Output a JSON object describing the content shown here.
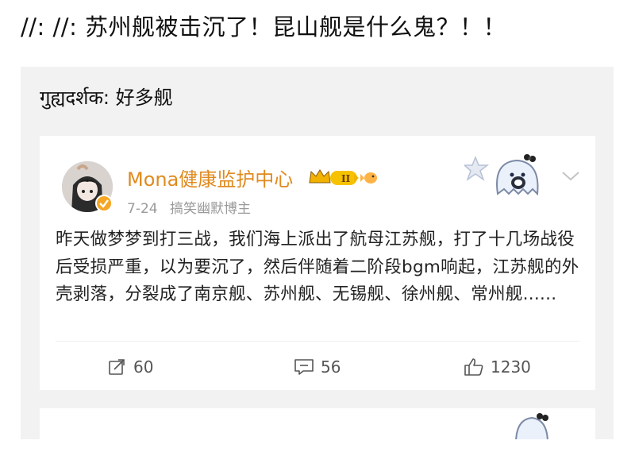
{
  "caption": "//: //: 苏州舰被击沉了！昆山舰是什么鬼？！！",
  "quote": {
    "text": "गुह्यदर्शक: 好多舰"
  },
  "post": {
    "username": "Mona健康监护中心",
    "date": "7-24",
    "category": "搞笑幽默博主",
    "body": "昨天做梦梦到打三战，我们海上派出了航母江苏舰，打了十几场战役后受损严重，以为要沉了，然后伴随着二阶段bgm响起，江苏舰的外壳剥落，分裂成了南京舰、苏州舰、无锡舰、徐州舰、常州舰......",
    "reposts": "60",
    "comments": "56",
    "likes": "1230"
  },
  "colors": {
    "username": "#e08a1e",
    "meta": "#9a9a9a",
    "box_bg": "#f2f2f2",
    "verified": "#f5a623"
  },
  "icons": [
    "avatar",
    "verified-icon",
    "crown-badge-icon",
    "level-badge-icon",
    "fish-badge-icon",
    "star-decoration-icon",
    "ghost-decoration-icon",
    "chevron-down-icon",
    "repost-icon",
    "comment-icon",
    "like-icon"
  ]
}
